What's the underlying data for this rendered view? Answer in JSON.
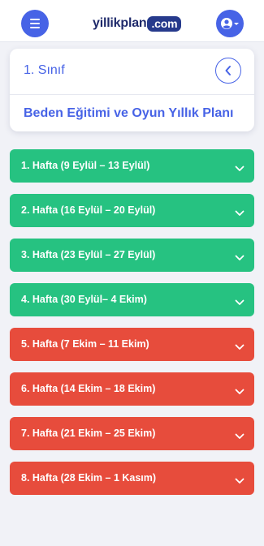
{
  "header": {
    "menu_icon": "hamburger-icon",
    "logo_text": "yillikplan",
    "logo_badge": ".com",
    "user_icon": "user-circle-icon"
  },
  "card": {
    "title": "1. Sınıf",
    "back_icon": "chevron-left-icon",
    "subtitle": "Beden Eğitimi ve Oyun Yıllık Planı"
  },
  "weeks": [
    {
      "label": "1. Hafta (9 Eylül – 13 Eylül)",
      "status": "green"
    },
    {
      "label": "2. Hafta (16 Eylül – 20 Eylül)",
      "status": "green"
    },
    {
      "label": "3. Hafta (23 Eylül – 27 Eylül)",
      "status": "green"
    },
    {
      "label": "4. Hafta (30 Eylül– 4 Ekim)",
      "status": "green"
    },
    {
      "label": "5. Hafta (7 Ekim – 11 Ekim)",
      "status": "red"
    },
    {
      "label": "6. Hafta (14 Ekim – 18 Ekim)",
      "status": "red"
    },
    {
      "label": "7. Hafta (21 Ekim – 25 Ekim)",
      "status": "red"
    },
    {
      "label": "8. Hafta (28 Ekim – 1 Kasım)",
      "status": "red"
    }
  ],
  "colors": {
    "accent": "#4763e6",
    "green": "#26c281",
    "red": "#e74c3c",
    "background": "#f1f2f7"
  }
}
